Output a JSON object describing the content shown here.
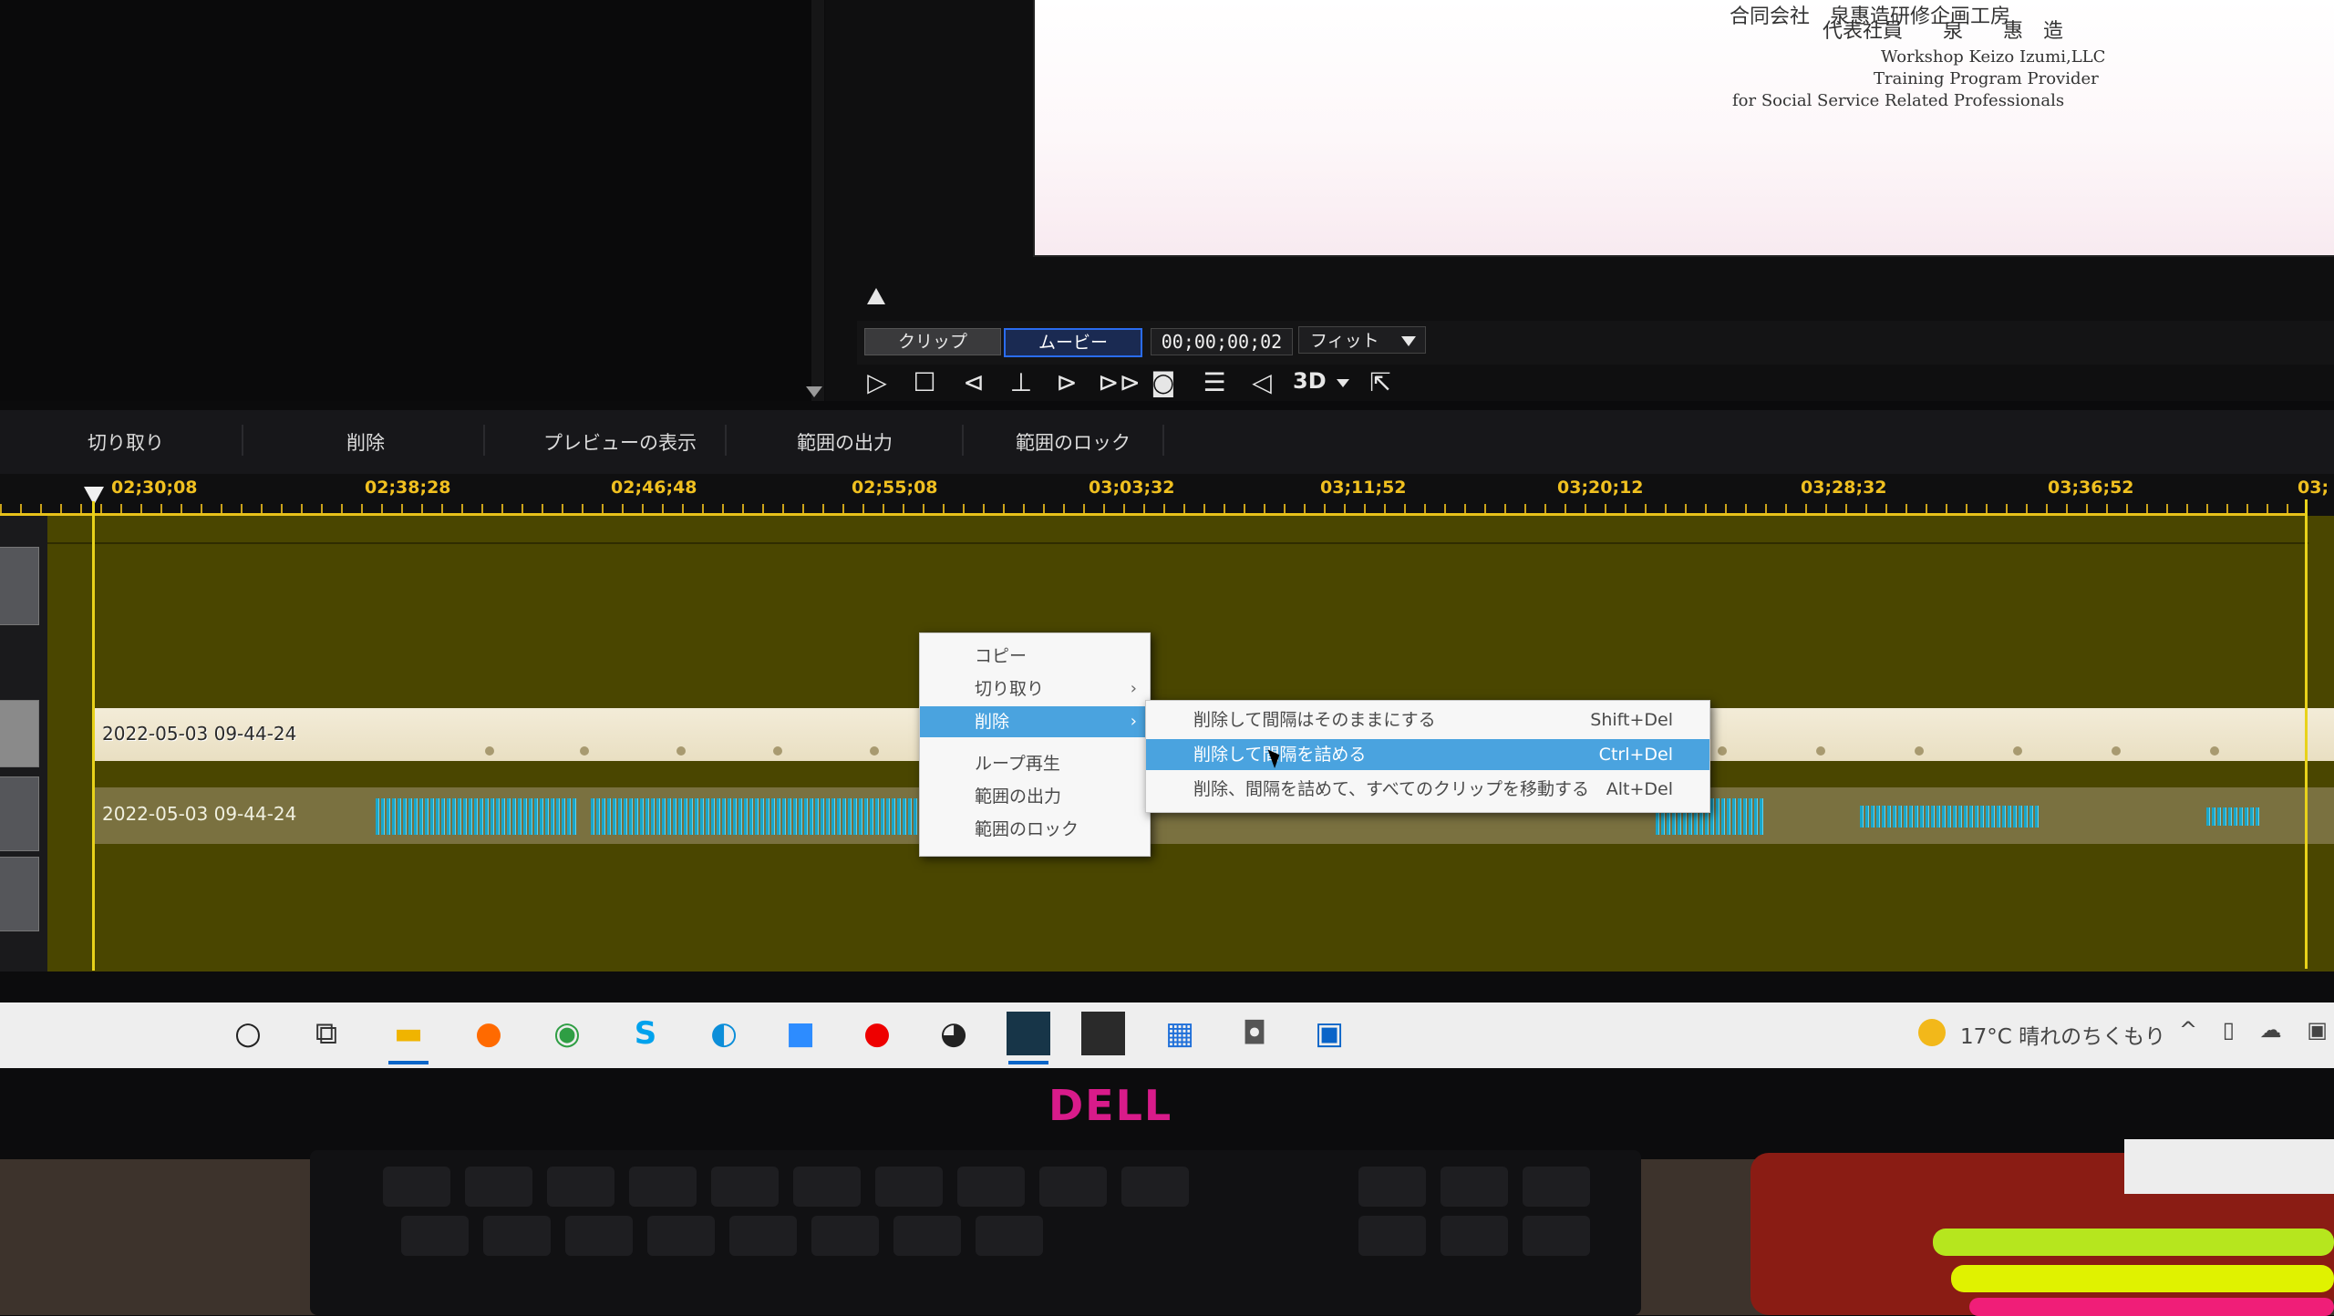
{
  "preview": {
    "company_line": "合同会社　泉惠造研修企画工房",
    "rep_line": "代表社員　　泉　　惠　造",
    "en_line1": "Workshop Keizo Izumi,LLC",
    "en_line2": "Training Program Provider",
    "en_line3": "for Social Service Related Professionals"
  },
  "controls": {
    "clip_tab": "クリップ",
    "movie_tab": "ムービー",
    "timecode": "00;00;00;02",
    "fit": "フィット",
    "label_3d": "3D",
    "icons": [
      "play-icon",
      "stop-icon",
      "prev-frame-icon",
      "split-icon",
      "next-frame-icon",
      "fast-forward-icon",
      "snapshot-icon",
      "subtitle-icon",
      "volume-icon",
      "popout-icon"
    ]
  },
  "edit_toolbar": {
    "cut": "切り取り",
    "delete": "削除",
    "preview": "プレビューの表示",
    "export_range": "範囲の出力",
    "lock_range": "範囲のロック"
  },
  "ruler": {
    "ticks": [
      "02;30;08",
      "02;38;28",
      "02;46;48",
      "02;55;08",
      "03;03;32",
      "03;11;52",
      "03;20;12",
      "03;28;32",
      "03;36;52",
      "03;"
    ]
  },
  "tracks": {
    "video_clip": "2022-05-03 09-44-24",
    "audio_clip": "2022-05-03 09-44-24"
  },
  "context_menu": {
    "items": [
      {
        "label": "コピー"
      },
      {
        "label": "切り取り"
      },
      {
        "label": "削除"
      },
      {
        "label": "ループ再生"
      },
      {
        "label": "範囲の出力"
      },
      {
        "label": "範囲のロック"
      }
    ]
  },
  "delete_submenu": {
    "items": [
      {
        "label": "削除して間隔はそのままにする",
        "shortcut": "Shift+Del"
      },
      {
        "label": "削除して間隔を詰める",
        "shortcut": "Ctrl+Del"
      },
      {
        "label": "削除、間隔を詰めて、すべてのクリップを移動する",
        "shortcut": "Alt+Del"
      }
    ]
  },
  "taskbar": {
    "weather": "17°C 晴れのちくもり",
    "icons": [
      "cortana-icon",
      "task-view-icon",
      "file-explorer-icon",
      "firefox-icon",
      "chrome-icon",
      "skype-icon",
      "edge-icon",
      "zoom-icon",
      "record-icon",
      "obs-icon",
      "powerdirector-icon",
      "app-icon",
      "video-editor-icon",
      "camera-icon",
      "outlook-icon"
    ]
  },
  "monitor": {
    "brand": "DELL"
  },
  "colors": {
    "timeline_bg": "#4a4600",
    "ruler_accent": "#e8c21a",
    "menu_highlight": "#4aa3df",
    "movie_tab_border": "#2a6cf0",
    "brand_logo": "#d81b8a"
  }
}
